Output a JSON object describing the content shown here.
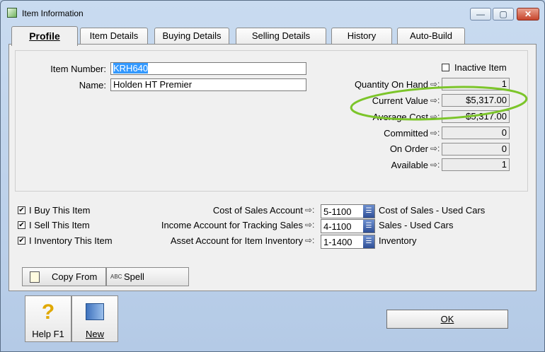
{
  "window": {
    "title": "Item Information",
    "controls": {
      "minimize": "—",
      "maximize": "▢",
      "close": "✕"
    }
  },
  "tabs": [
    "Profile",
    "Item Details",
    "Buying Details",
    "Selling Details",
    "History",
    "Auto-Build"
  ],
  "profile": {
    "item_number_label": "Item Number:",
    "item_number": "KRH640",
    "name_label": "Name:",
    "name": "Holden HT Premier",
    "inactive_label": "Inactive Item",
    "inactive_checked": false,
    "arrow": "⇨:",
    "stats": [
      {
        "label": "Quantity On Hand",
        "value": "1"
      },
      {
        "label": "Current Value",
        "value": "$5,317.00"
      },
      {
        "label": "Average Cost",
        "value": "$5,317.00"
      },
      {
        "label": "Committed",
        "value": "0"
      },
      {
        "label": "On Order",
        "value": "0"
      },
      {
        "label": "Available",
        "value": "1"
      }
    ]
  },
  "options": [
    {
      "label": "I Buy This Item",
      "checked": "✔"
    },
    {
      "label": "I Sell This Item",
      "checked": "✔"
    },
    {
      "label": "I Inventory This Item",
      "checked": "✔"
    }
  ],
  "accounts": [
    {
      "label": "Cost of Sales Account",
      "code": "5-1100",
      "name": "Cost of Sales - Used Cars"
    },
    {
      "label": "Income Account for Tracking Sales",
      "code": "4-1100",
      "name": "Sales - Used Cars"
    },
    {
      "label": "Asset Account for Item Inventory",
      "code": "1-1400",
      "name": "Inventory"
    }
  ],
  "buttons": {
    "copy_from": "Copy From",
    "spell": "Spell",
    "spell_icon_text": "ABC",
    "help": "Help F1",
    "new": "New",
    "ok": "OK"
  },
  "colors": {
    "highlight_ellipse": "#7cc52a",
    "selection": "#3399ff"
  }
}
